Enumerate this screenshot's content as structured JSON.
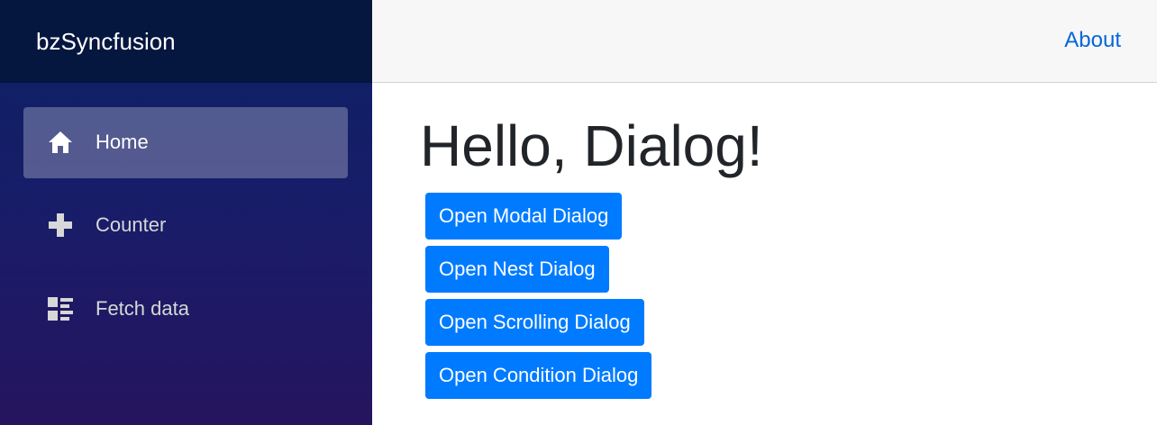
{
  "sidebar": {
    "brand": "bzSyncfusion",
    "items": [
      {
        "label": "Home",
        "icon": "home-icon",
        "active": true
      },
      {
        "label": "Counter",
        "icon": "plus-icon",
        "active": false
      },
      {
        "label": "Fetch data",
        "icon": "list-icon",
        "active": false
      }
    ]
  },
  "topbar": {
    "about_label": "About"
  },
  "main": {
    "title": "Hello, Dialog!",
    "buttons": [
      {
        "label": "Open Modal Dialog"
      },
      {
        "label": "Open Nest Dialog"
      },
      {
        "label": "Open Scrolling Dialog"
      },
      {
        "label": "Open Condition Dialog"
      }
    ]
  },
  "colors": {
    "sidebar_top": "#0b2266",
    "sidebar_bottom": "#26145e",
    "brand_bar": "#05163f",
    "button": "#007bff",
    "link": "#0366d6"
  }
}
